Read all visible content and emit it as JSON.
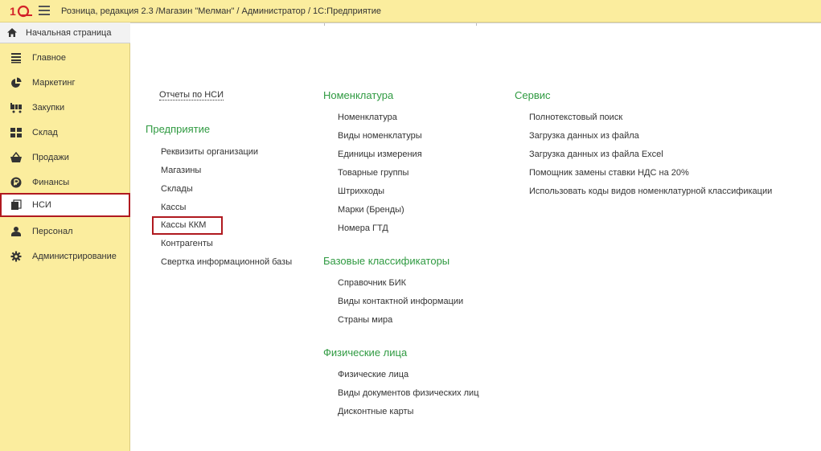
{
  "titlebar": {
    "title": "Розница, редакция 2.3 /Магазин \"Мелман\" / Администратор / 1С:Предприятие",
    "logo_icon": "1c-logo-icon",
    "menu_icon": "hamburger-menu-icon"
  },
  "sidebar": {
    "home": {
      "label": "Начальная страница",
      "icon": "home-icon"
    },
    "items": [
      {
        "label": "Главное",
        "icon": "list-icon"
      },
      {
        "label": "Маркетинг",
        "icon": "pie-chart-icon"
      },
      {
        "label": "Закупки",
        "icon": "cart-icon"
      },
      {
        "label": "Склад",
        "icon": "grid-icon"
      },
      {
        "label": "Продажи",
        "icon": "basket-icon"
      },
      {
        "label": "Финансы",
        "icon": "coin-icon"
      },
      {
        "label": "НСИ",
        "icon": "book-icon"
      },
      {
        "label": "Персонал",
        "icon": "person-icon"
      },
      {
        "label": "Администрирование",
        "icon": "gear-icon"
      }
    ],
    "active_item": "НСИ"
  },
  "main": {
    "reports_link": "Отчеты по НСИ",
    "enterprise": {
      "title": "Предприятие",
      "links": [
        "Реквизиты организации",
        "Магазины",
        "Склады",
        "Кассы",
        "Кассы ККМ",
        "Контрагенты",
        "Свертка информационной базы"
      ]
    },
    "nomenclature": {
      "title": "Номенклатура",
      "links": [
        "Номенклатура",
        "Виды номенклатуры",
        "Единицы измерения",
        "Товарные группы",
        "Штрихкоды",
        "Марки (Бренды)",
        "Номера ГТД"
      ]
    },
    "classifiers": {
      "title": "Базовые классификаторы",
      "links": [
        "Справочник БИК",
        "Виды контактной информации",
        "Страны мира"
      ]
    },
    "persons": {
      "title": "Физические лица",
      "links": [
        "Физические лица",
        "Виды документов физических лиц",
        "Дисконтные карты"
      ]
    },
    "service": {
      "title": "Сервис",
      "links": [
        "Полнотекстовый поиск",
        "Загрузка данных из файла",
        "Загрузка данных из файла Excel",
        "Помощник замены ставки НДС на 20%",
        "Использовать коды видов номенклатурной классификации"
      ]
    }
  },
  "colors": {
    "accent_green": "#2f9a41",
    "highlight_red": "#b0191f",
    "panel_yellow": "#fbed9e"
  }
}
